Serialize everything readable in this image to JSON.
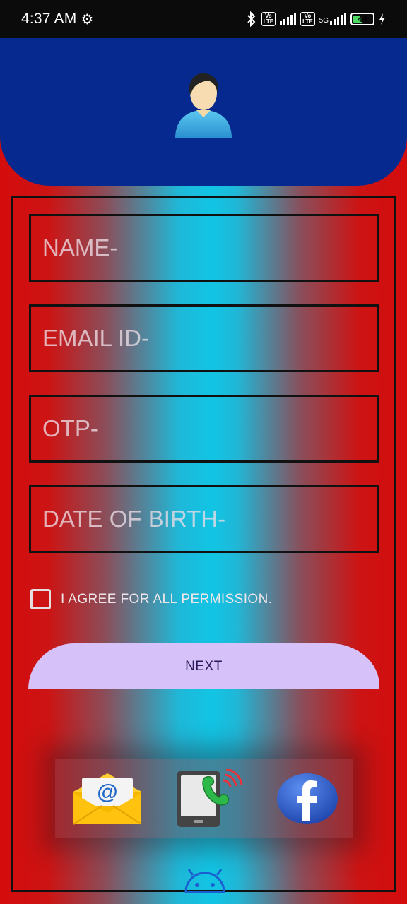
{
  "status_bar": {
    "time": "4:37 AM",
    "icons": [
      "gear-icon",
      "bluetooth-icon",
      "volte-icon",
      "signal-icon",
      "volte-icon",
      "signal-5g-icon",
      "battery-icon",
      "charging-icon"
    ],
    "volte_label": "Vo LTE",
    "network": "5G",
    "battery_level": "44"
  },
  "header": {
    "avatar_icon": "user-avatar-icon",
    "color": "#06298f"
  },
  "form": {
    "name_placeholder": "NAME-",
    "email_placeholder": "EMAIL ID-",
    "otp_placeholder": "OTP-",
    "dob_placeholder": "DATE OF BIRTH-",
    "agree_label": "I AGREE FOR ALL PERMISSION.",
    "agree_checked": false,
    "next_label": "NEXT",
    "next_color": "#d6c1f8"
  },
  "social": {
    "icons": [
      "email-icon",
      "phone-call-icon",
      "facebook-icon"
    ]
  },
  "footer": {
    "icon": "android-icon"
  },
  "colors": {
    "background_edge": "#d40c0c",
    "background_center": "#12c4e4"
  }
}
